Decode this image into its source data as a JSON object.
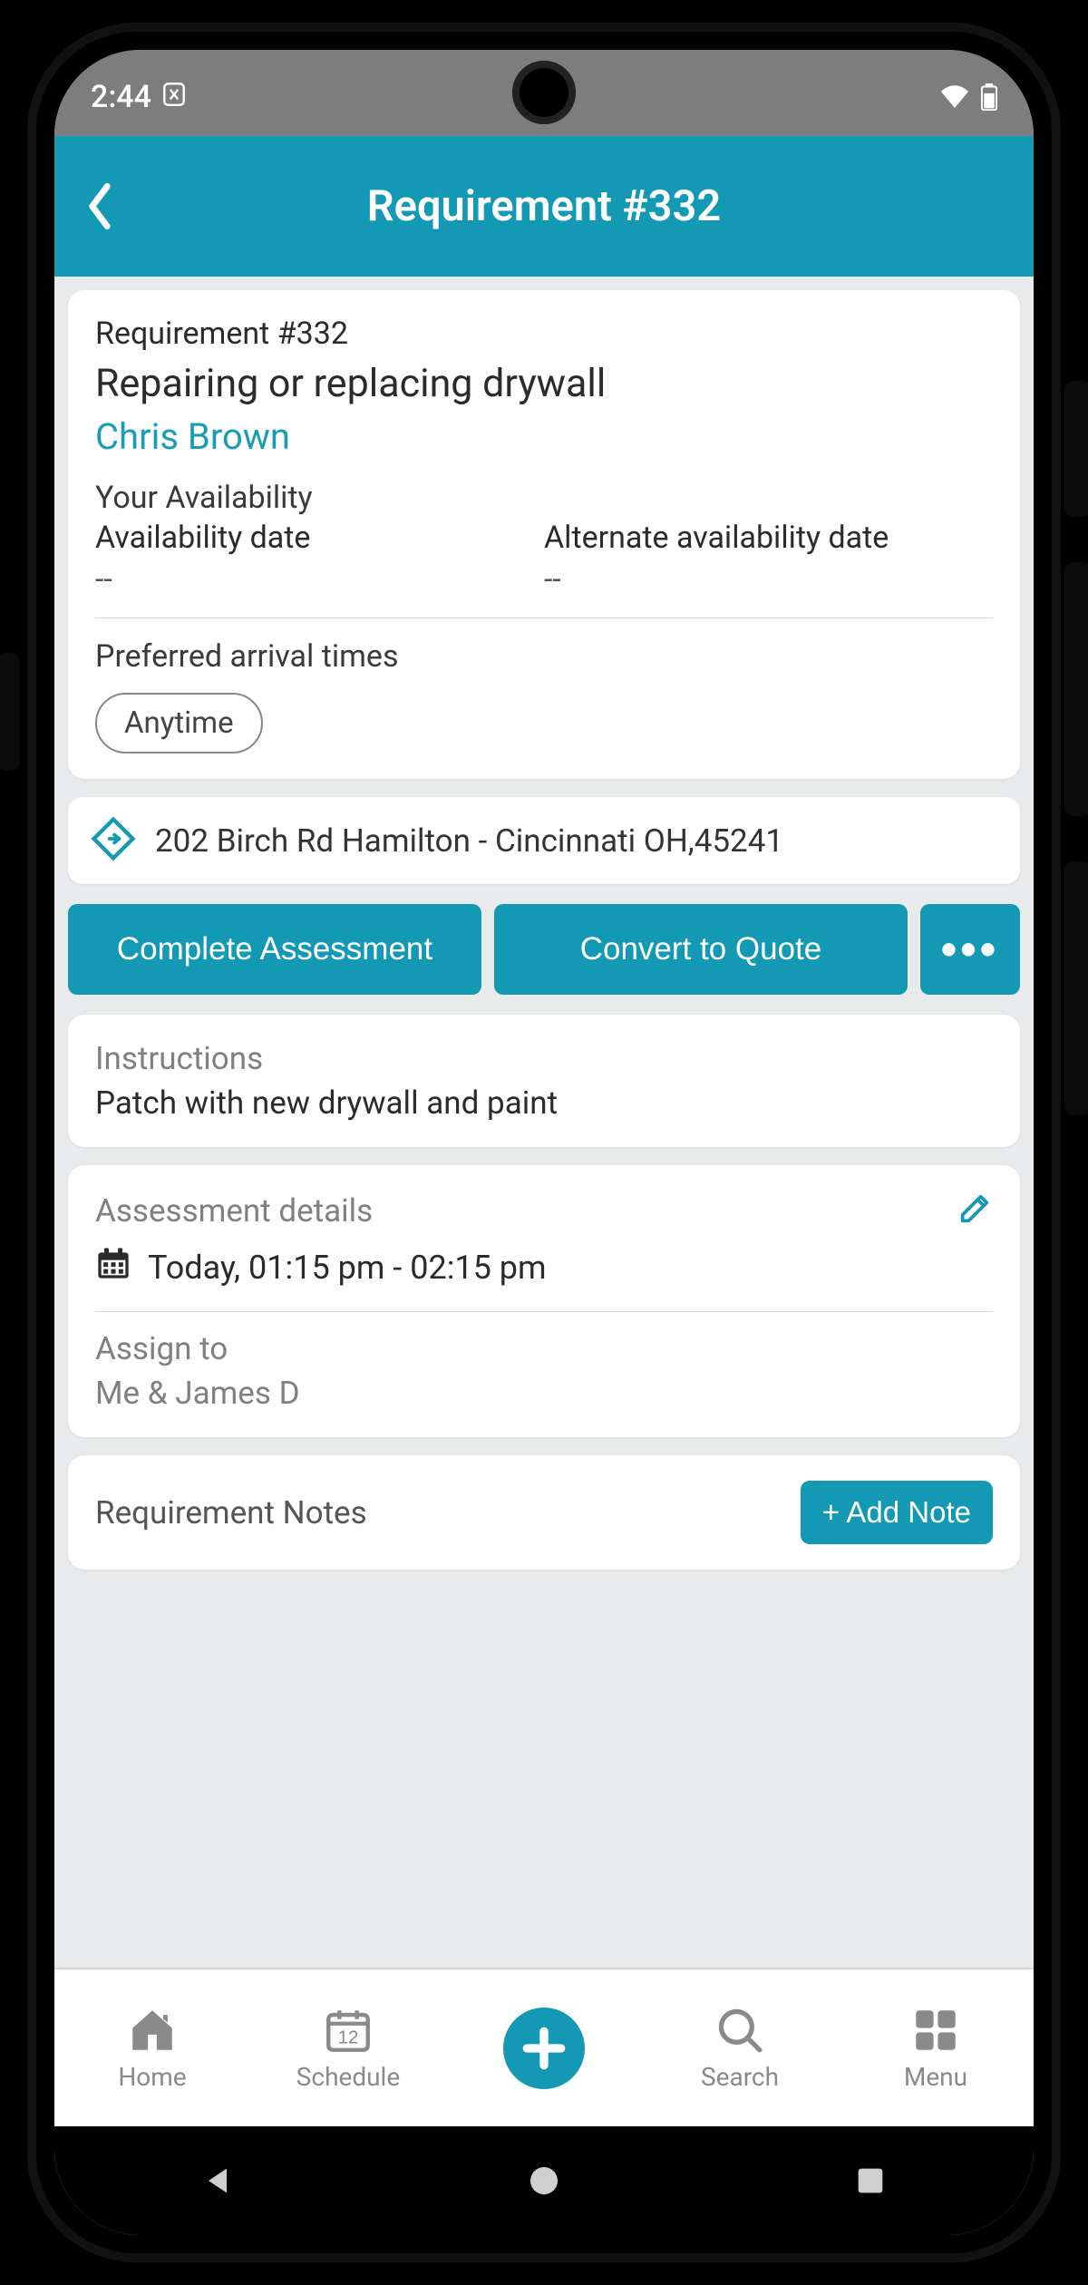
{
  "status": {
    "time": "2:44"
  },
  "header": {
    "title": "Requirement #332"
  },
  "main": {
    "card_id": "Requirement #332",
    "title": "Repairing or replacing drywall",
    "customer": "Chris Brown",
    "availability_label": "Your Availability",
    "availability_date_label": "Availability date",
    "availability_date_value": "--",
    "alt_availability_date_label": "Alternate availability date",
    "alt_availability_date_value": "--",
    "preferred_times_label": "Preferred arrival times",
    "preferred_times_value": "Anytime"
  },
  "address": "202 Birch Rd Hamilton - Cincinnati OH,45241",
  "actions": {
    "complete_assessment": "Complete Assessment",
    "convert_quote": "Convert to Quote",
    "more": "•••"
  },
  "instructions": {
    "label": "Instructions",
    "text": "Patch with new drywall and paint"
  },
  "assessment": {
    "label": "Assessment details",
    "when": "Today, 01:15 pm - 02:15 pm",
    "assign_label": "Assign to",
    "assign_value": "Me & James D"
  },
  "notes": {
    "label": "Requirement Notes",
    "add_btn": "+ Add Note"
  },
  "tabs": {
    "home": "Home",
    "schedule": "Schedule",
    "search": "Search",
    "menu": "Menu"
  }
}
